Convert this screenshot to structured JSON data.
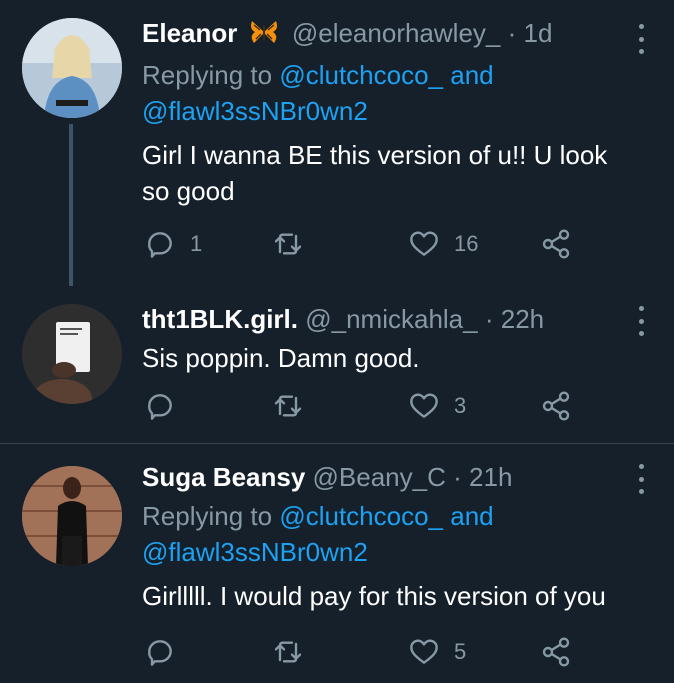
{
  "tweets": [
    {
      "name": "Eleanor",
      "handle": "@eleanorhawley_",
      "time": "1d",
      "replying_prefix": "Replying to",
      "replying_mention1": "@clutchcoco_",
      "replying_and": "and",
      "replying_mention2": "@flawl3ssNBr0wn2",
      "text": "Girl I wanna BE this version of u!! U look so good",
      "reply_count": "1",
      "like_count": "16",
      "name_emoji_icon": "butterfly-icon"
    },
    {
      "name": "tht1BLK.girl.",
      "handle": "@_nmickahla_",
      "time": "22h",
      "text": "Sis poppin. Damn good.",
      "reply_count": "",
      "like_count": "3"
    },
    {
      "name": "Suga Beansy",
      "handle": "@Beany_C",
      "time": "21h",
      "replying_prefix": "Replying to",
      "replying_mention1": "@clutchcoco_",
      "replying_and": "and",
      "replying_mention2": "@flawl3ssNBr0wn2",
      "text": "Girlllll. I would pay for this version of you",
      "reply_count": "",
      "like_count": "5"
    }
  ],
  "colors": {
    "background": "#15202b",
    "secondary_text": "#8899a6",
    "accent": "#1da1f2",
    "divider": "#38444d"
  }
}
